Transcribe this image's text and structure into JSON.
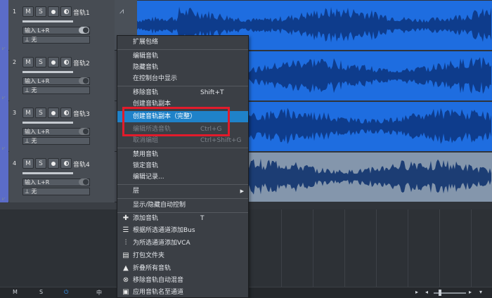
{
  "tracks": [
    {
      "num": "1",
      "name": "音轨1",
      "input": "输入 L+R",
      "output": "无",
      "m": "M",
      "s": "S",
      "selected": true
    },
    {
      "num": "2",
      "name": "音轨2",
      "input": "输入 L+R",
      "output": "无",
      "m": "M",
      "s": "S",
      "selected": false
    },
    {
      "num": "3",
      "name": "音轨3",
      "input": "输入 L+R",
      "output": "无",
      "m": "M",
      "s": "S",
      "selected": false
    },
    {
      "num": "4",
      "name": "音轨4",
      "input": "输入 L+R",
      "output": "无",
      "m": "M",
      "s": "S",
      "selected": false
    }
  ],
  "bottom_bar": {
    "m": "M",
    "s": "S",
    "mid": "中"
  },
  "context_menu": {
    "expand_envelope": "扩展包络",
    "edit_track": "编辑音轨",
    "hide_track": "隐藏音轨",
    "show_in_console": "在控制台中显示",
    "remove_track": "移除音轨",
    "remove_track_shortcut": "Shift+T",
    "create_track_copy": "创建音轨副本",
    "create_track_copy_full": "创建音轨副本（完整）",
    "edit_selected_tracks": "编辑所选音轨",
    "edit_selected_shortcut": "Ctrl+G",
    "ungroup": "取消编组",
    "ungroup_shortcut": "Ctrl+Shift+G",
    "disable_track": "禁用音轨",
    "lock_track": "锁定音轨",
    "edit_history": "编辑记录...",
    "layer": "层",
    "toggle_automation": "显示/隐藏自动控制",
    "add_track": "添加音轨",
    "add_track_shortcut": "T",
    "add_bus": "根据所选通道添加Bus",
    "add_vca": "为所选通道添加VCA",
    "pack_folder": "打包文件夹",
    "collapse_all": "折叠所有音轨",
    "remove_automix": "移除音轨自动混音",
    "apply_names": "应用音轨名至通道"
  },
  "colors": {
    "track_strip": "#5b6cc8",
    "clip_blue": "#1e6de0",
    "clip_gray": "#8496ac",
    "menu_highlight": "#1f82c9",
    "annotation_red": "#e21b2b"
  },
  "icons": [
    "waveform-icon",
    "plus-icon",
    "bus-icon",
    "vca-icon",
    "folder-icon",
    "collapse-icon",
    "automix-icon",
    "apply-icon",
    "chevron-right-icon"
  ]
}
